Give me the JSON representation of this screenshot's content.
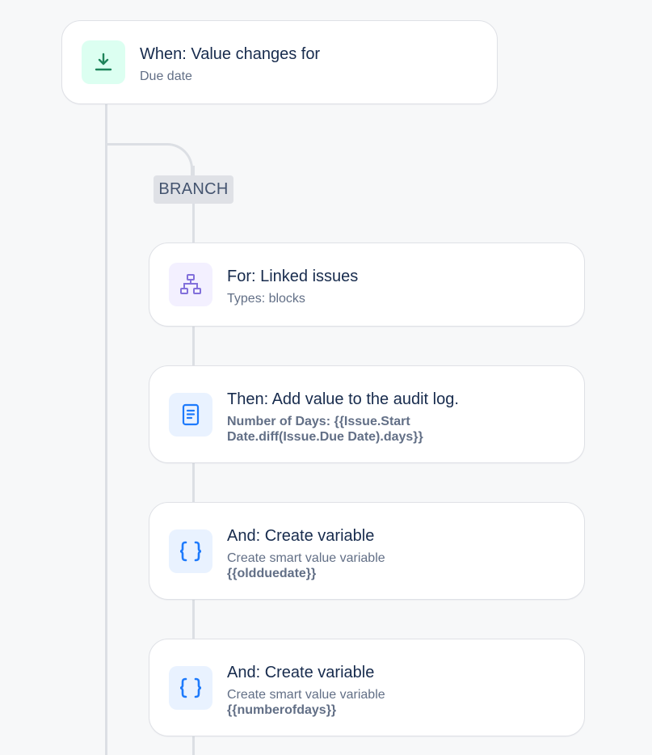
{
  "trigger": {
    "title": "When: Value changes for",
    "subtitle": "Due date",
    "icon": "download-arrow-icon",
    "icon_color": "#1f845a",
    "icon_bg": "#dcfff1"
  },
  "branch": {
    "label": "BRANCH"
  },
  "steps": [
    {
      "title": "For: Linked issues",
      "subtitle": "Types: blocks",
      "icon": "hierarchy-icon",
      "icon_color": "#8270db",
      "icon_bg": "#f3f0ff"
    },
    {
      "title": "Then: Add value to the audit log.",
      "detail_line1": "Number of Days: {{Issue.Start",
      "detail_line2": "Date.diff(Issue.Due Date).days}}",
      "icon": "document-icon",
      "icon_color": "#1d7afc",
      "icon_bg": "#e9f2ff"
    },
    {
      "title": "And: Create variable",
      "subtitle": "Create smart value variable",
      "detail": "{{oldduedate}}",
      "icon": "curly-braces-icon",
      "icon_color": "#1d7afc",
      "icon_bg": "#e9f2ff"
    },
    {
      "title": "And: Create variable",
      "subtitle": "Create smart value variable",
      "detail": "{{numberofdays}}",
      "icon": "curly-braces-icon",
      "icon_color": "#1d7afc",
      "icon_bg": "#e9f2ff"
    }
  ]
}
